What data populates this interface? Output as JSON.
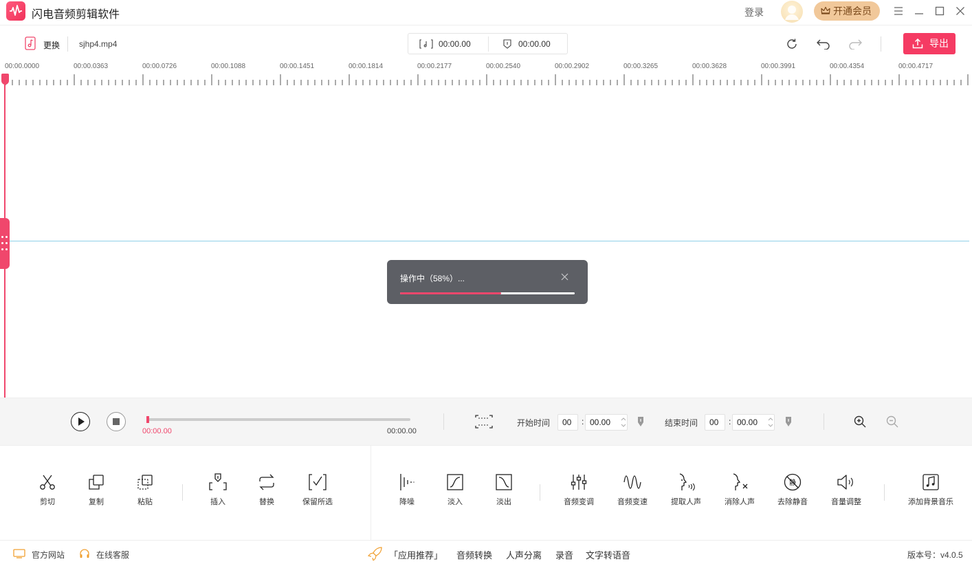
{
  "app": {
    "title": "闪电音频剪辑软件"
  },
  "header": {
    "login": "登录",
    "vip": "开通会员"
  },
  "toolbar": {
    "replace": "更换",
    "file_name": "sjhp4.mp4",
    "start_time": "00:00.00",
    "end_time": "00:00.00",
    "export": "导出"
  },
  "ruler": {
    "labels": [
      "00:00.0000",
      "00:00.0363",
      "00:00.0726",
      "00:00.1088",
      "00:00.1451",
      "00:00.1814",
      "00:00.2177",
      "00:00.2540",
      "00:00.2902",
      "00:00.3265",
      "00:00.3628",
      "00:00.3991",
      "00:00.4354",
      "00:00.4717"
    ]
  },
  "dialog": {
    "text": "操作中（58%）...",
    "progress": 0.58
  },
  "playback": {
    "current": "00:00.00",
    "total": "00:00.00",
    "start_label": "开始时间",
    "end_label": "结束时间",
    "start_min": "00",
    "start_sec": "00.00",
    "end_min": "00",
    "end_sec": "00.00",
    "colon": ":"
  },
  "tools": {
    "cut": "剪切",
    "copy": "复制",
    "paste": "粘贴",
    "insert": "插入",
    "replace": "替换",
    "keep": "保留所选",
    "denoise": "降噪",
    "fadein": "淡入",
    "fadeout": "淡出",
    "pitch": "音频变调",
    "speed": "音频变速",
    "extract_voice": "提取人声",
    "remove_voice": "消除人声",
    "remove_silence": "去除静音",
    "volume": "音量调整",
    "bgm": "添加背景音乐"
  },
  "status": {
    "website": "官方网站",
    "service": "在线客服",
    "recommend": "「应用推荐」",
    "links": [
      "音频转换",
      "人声分离",
      "录音",
      "文字转语音"
    ],
    "version": "版本号：v4.0.5"
  },
  "colors": {
    "accent": "#f0476c",
    "export": "#f53b63",
    "vip": "#f1c89a"
  }
}
